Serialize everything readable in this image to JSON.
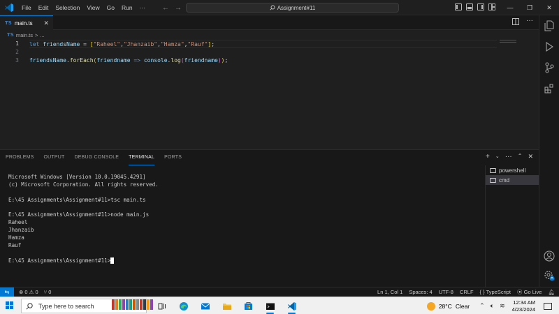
{
  "title_bar": {
    "menu": [
      "File",
      "Edit",
      "Selection",
      "View",
      "Go",
      "Run",
      "···"
    ],
    "search_text": "Assignment#11"
  },
  "editor": {
    "tab": {
      "badge": "TS",
      "label": "main.ts"
    },
    "breadcrumb": {
      "badge": "TS",
      "file": "main.ts",
      "separator": ">",
      "more": "..."
    },
    "line_numbers": [
      "1",
      "2",
      "3"
    ]
  },
  "panel": {
    "tabs": [
      "PROBLEMS",
      "OUTPUT",
      "DEBUG CONSOLE",
      "TERMINAL",
      "PORTS"
    ],
    "active_tab": "TERMINAL",
    "terminal_lines": [
      "Microsoft Windows [Version 10.0.19045.4291]",
      "(c) Microsoft Corporation. All rights reserved.",
      "",
      "E:\\45 Assignments\\Assignment#11>tsc main.ts",
      "",
      "E:\\45 Assignments\\Assignment#11>node main.js",
      "Raheel",
      "Jhanzaib",
      "Hamza",
      "Rauf",
      ""
    ],
    "prompt": "E:\\45 Assignments\\Assignment#11>",
    "terminals": [
      {
        "label": "powershell",
        "active": false
      },
      {
        "label": "cmd",
        "active": true
      }
    ]
  },
  "status_bar": {
    "errors": "0",
    "warnings": "0",
    "ports": "0",
    "position": "Ln 1, Col 1",
    "spaces": "Spaces: 4",
    "encoding": "UTF-8",
    "eol": "CRLF",
    "language": "TypeScript",
    "golive": "Go Live"
  },
  "taskbar": {
    "search_placeholder": "Type here to search",
    "temperature": "28°C",
    "weather": "Clear",
    "time": "12:34 AM",
    "date": "4/23/2024"
  },
  "colors": {
    "accent": "#0078d4",
    "editor_bg": "#1f1f1f",
    "panel_bg": "#181818",
    "keyword": "#569cd6",
    "variable": "#9cdcfe",
    "string": "#ce9178",
    "function": "#dcdcaa"
  }
}
